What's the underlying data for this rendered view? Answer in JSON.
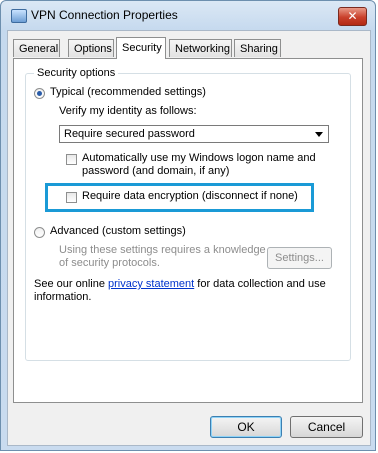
{
  "window": {
    "title": "VPN Connection Properties",
    "close_glyph": "✕"
  },
  "tabs": [
    {
      "label": "General",
      "active": false
    },
    {
      "label": "Options",
      "active": false
    },
    {
      "label": "Security",
      "active": true
    },
    {
      "label": "Networking",
      "active": false
    },
    {
      "label": "Sharing",
      "active": false
    }
  ],
  "security": {
    "group_label": "Security options",
    "typical_label": "Typical (recommended settings)",
    "typical_selected": true,
    "verify_label": "Verify my identity as follows:",
    "verify_select_value": "Require secured password",
    "auto_logon_line1": "Automatically use my Windows logon name and",
    "auto_logon_line2": "password (and domain, if any)",
    "auto_logon_checked": false,
    "encryption_label": "Require data encryption (disconnect if none)",
    "encryption_checked": false,
    "advanced_label": "Advanced (custom settings)",
    "advanced_selected": false,
    "advanced_note_line1": "Using these settings requires a knowledge",
    "advanced_note_line2": "of security protocols.",
    "settings_button": "Settings...",
    "privacy_prefix": "See our online",
    "privacy_link": "privacy statement",
    "privacy_suffix": "for data collection and use",
    "privacy_line2": "information."
  },
  "buttons": {
    "ok": "OK",
    "cancel": "Cancel"
  },
  "colors": {
    "highlight_border": "#1a9ad6",
    "link": "#0033cc",
    "close_button": "#c9402b"
  }
}
